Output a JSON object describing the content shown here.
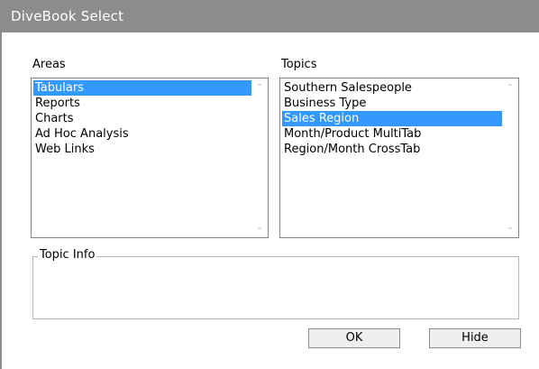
{
  "window": {
    "title": "DiveBook Select"
  },
  "areas": {
    "label": "Areas",
    "items": [
      "Tabulars",
      "Reports",
      "Charts",
      "Ad Hoc Analysis",
      "Web Links"
    ],
    "selected": "Tabulars"
  },
  "topics": {
    "label": "Topics",
    "items": [
      "Southern Salespeople",
      "Business Type",
      "Sales Region",
      "Month/Product MultiTab",
      "Region/Month CrossTab"
    ],
    "selected": "Sales Region"
  },
  "topic_info": {
    "label": "Topic Info"
  },
  "buttons": {
    "ok": "OK",
    "hide": "Hide"
  },
  "colors": {
    "titlebar": "#8c8c8c",
    "selection": "#3399ff"
  }
}
